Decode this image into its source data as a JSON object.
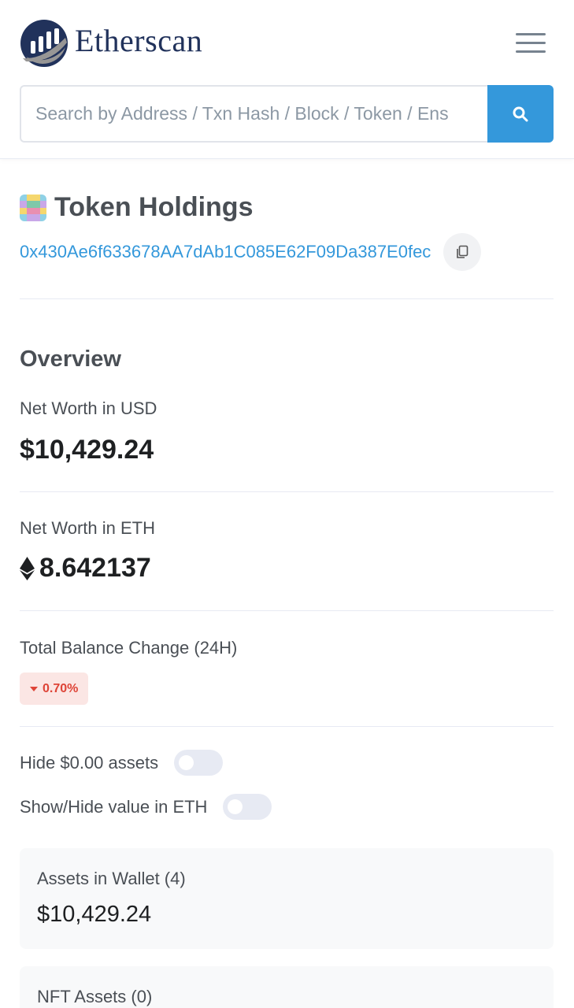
{
  "header": {
    "brand": "Etherscan",
    "search_placeholder": "Search by Address / Txn Hash / Block / Token / Ens",
    "icons": {
      "logo": "etherscan-logo",
      "menu": "hamburger-menu-icon",
      "search": "search-icon"
    }
  },
  "title": {
    "heading": "Token Holdings",
    "address": "0x430Ae6f633678AA7dAb1C085E62F09Da387E0fec",
    "copy_icon": "copy-icon"
  },
  "overview": {
    "heading": "Overview",
    "net_worth_usd_label": "Net Worth in USD",
    "net_worth_usd_value": "$10,429.24",
    "net_worth_eth_label": "Net Worth in ETH",
    "net_worth_eth_value": "8.642137",
    "balance_change_label": "Total Balance Change (24H)",
    "balance_change_value": "0.70%",
    "balance_change_direction": "down"
  },
  "toggles": {
    "hide_zero_label": "Hide $0.00 assets",
    "hide_zero_on": false,
    "show_eth_label": "Show/Hide value in ETH",
    "show_eth_on": false
  },
  "cards": {
    "wallet_label": "Assets in Wallet (4)",
    "wallet_value": "$10,429.24",
    "nft_label": "NFT Assets (0)"
  },
  "colors": {
    "brand_navy": "#21325b",
    "accent_blue": "#3498db",
    "down_red": "#de4437",
    "down_bg": "#fbe6e4"
  }
}
